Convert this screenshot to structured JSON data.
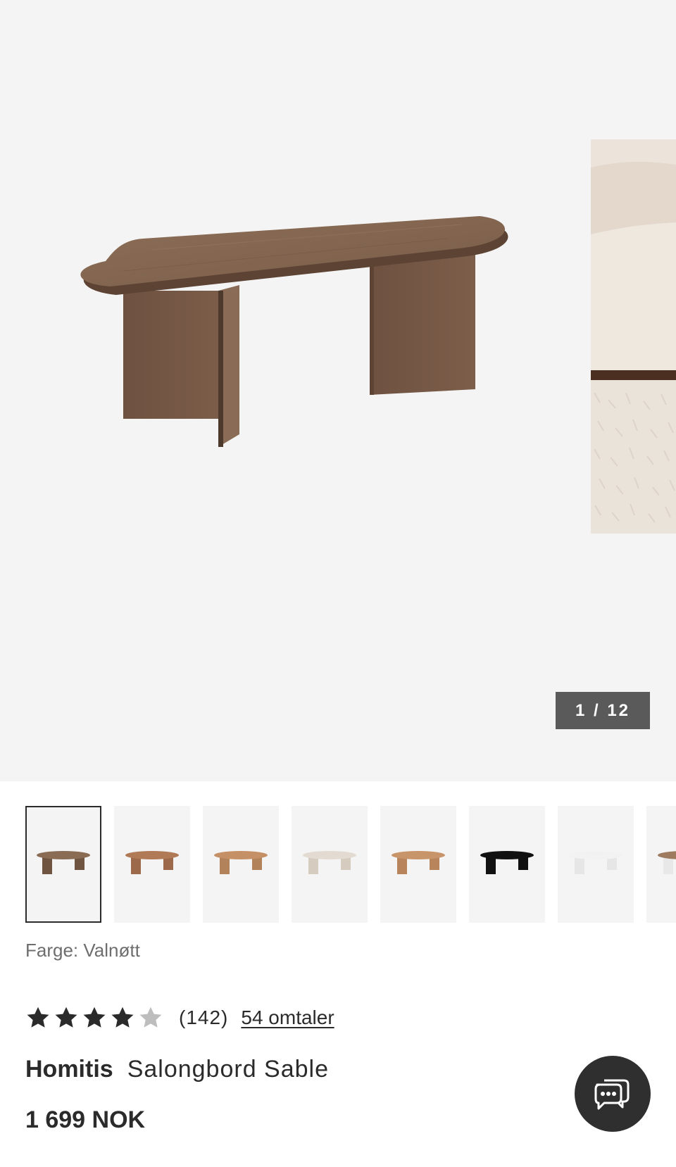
{
  "gallery": {
    "counter": "1 / 12",
    "main_image": "walnut-oval-coffee-table-image",
    "peek_image": "cream-sofa-on-rug-image"
  },
  "thumbnails": [
    {
      "color": "#8a6c55",
      "leg": "#6f5442",
      "selected": true
    },
    {
      "color": "#b07a57",
      "leg": "#9c6a4a",
      "selected": false
    },
    {
      "color": "#c69066",
      "leg": "#b2825b",
      "selected": false
    },
    {
      "color": "#e3dbd1",
      "leg": "#d5cbbf",
      "selected": false
    },
    {
      "color": "#c8946a",
      "leg": "#b8845b",
      "selected": false
    },
    {
      "color": "#111111",
      "leg": "#111111",
      "selected": false
    },
    {
      "color": "#f2f2f2",
      "leg": "#e6e6e6",
      "selected": false
    },
    {
      "color": "#9e7a5f",
      "leg": "#e8e8e8",
      "selected": false
    }
  ],
  "color_label": "Farge: Valnøtt",
  "rating": {
    "stars": 4,
    "max_stars": 5,
    "count": "(142)",
    "reviews_link": "54 omtaler"
  },
  "product": {
    "brand": "Homitis",
    "name": "Salongbord Sable",
    "price": "1 699 NOK"
  },
  "colors": {
    "star_filled": "#2b2b2b",
    "star_empty": "#bdbdbd",
    "counter_bg": "#5a5a5a",
    "chat_bg": "#2f2f2f"
  },
  "icons": {
    "chat": "chat-bubbles-icon",
    "star": "star-icon"
  }
}
